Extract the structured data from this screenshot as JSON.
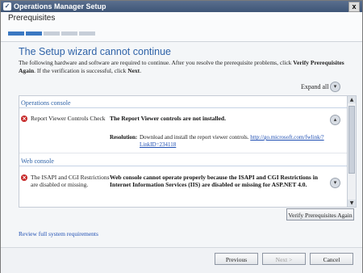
{
  "window": {
    "title": "Operations Manager Setup",
    "close_glyph": "x"
  },
  "header": {
    "step_title": "Prerequisites",
    "progress": {
      "done_segments": 2,
      "total_segments": 5
    }
  },
  "main": {
    "heading": "The Setup wizard cannot continue",
    "description_pre": "The following hardware and software are required to continue.  After you resolve the prerequisite problems, click ",
    "description_bold1": "Verify Prerequisites Again",
    "description_mid": ". If the verification is successful, click ",
    "description_bold2": "Next",
    "description_end": ".",
    "expand_all": "Expand all"
  },
  "sections": [
    {
      "title": "Operations console",
      "check": "Report Viewer Controls Check",
      "message": "The Report Viewer controls are not installed.",
      "resolution_label": "Resolution:",
      "resolution_text": "Download and install the report viewer controls.",
      "resolution_link": "http://go.microsoft.com/fwlink/?LinkID=234118"
    },
    {
      "title": "Web console",
      "check": "The ISAPI and CGI Restrictions are disabled or missing.",
      "message": "Web console cannot operate properly because the ISAPI and CGI Restrictions in Internet Information Services (IIS) are disabled or missing for ASP.NET 4.0."
    }
  ],
  "buttons": {
    "verify": "Verify Prerequisites Again",
    "previous": "Previous",
    "next": "Next >",
    "cancel": "Cancel"
  },
  "review_link": "Review full system requirements"
}
